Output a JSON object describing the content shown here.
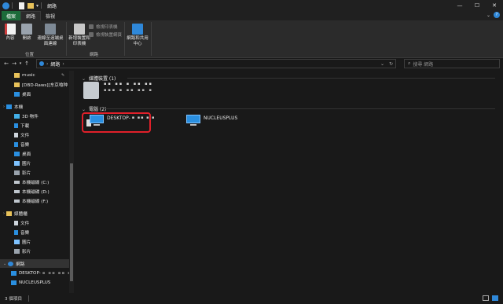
{
  "window": {
    "title": "網路",
    "controls": [
      "—",
      "☐",
      "✕"
    ]
  },
  "tabs": [
    {
      "label": "檔案"
    },
    {
      "label": "網路"
    },
    {
      "label": "檢視"
    }
  ],
  "ribbon": {
    "location_group": {
      "label": "位置",
      "buttons": [
        {
          "label": "內容"
        },
        {
          "label": "開啟"
        },
        {
          "label": "連線至遠端桌面連線"
        }
      ]
    },
    "network_group": {
      "label": "網路",
      "big_button": "新增裝置和印表機",
      "small_buttons": [
        "檢視印表機",
        "檢視裝置網頁"
      ],
      "extra_button": "網路和共用中心"
    }
  },
  "address": {
    "path": "網路",
    "search_placeholder": "搜尋 網路"
  },
  "sidebar": {
    "items": [
      {
        "label": "music"
      },
      {
        "label": "[DBD-Raws][东京喰种"
      },
      {
        "label": "桌面"
      },
      {
        "label": "本機"
      },
      {
        "label": "3D 物件"
      },
      {
        "label": "下載"
      },
      {
        "label": "文件"
      },
      {
        "label": "音樂"
      },
      {
        "label": "桌面"
      },
      {
        "label": "圖片"
      },
      {
        "label": "影片"
      },
      {
        "label": "本機磁碟 (C:)"
      },
      {
        "label": "本機磁碟 (D:)"
      },
      {
        "label": "本機磁碟 (F:)"
      },
      {
        "label": "媒體櫃"
      },
      {
        "label": "文件"
      },
      {
        "label": "音樂"
      },
      {
        "label": "圖片"
      },
      {
        "label": "影片"
      },
      {
        "label": "網路"
      },
      {
        "label": "DESKTOP-"
      },
      {
        "label": "NUCLEUSPLUS"
      }
    ]
  },
  "main": {
    "media_section": "媒體裝置 (1)",
    "computer_section": "電腦 (2)",
    "computers": [
      {
        "name": "DESKTOP-"
      },
      {
        "name": "NUCLEUSPLUS"
      }
    ]
  },
  "status": {
    "count": "3 個項目"
  },
  "colors": {
    "background": "#191919",
    "file_tab": "#1c6b3a",
    "highlight": "#e0202a",
    "accent": "#2a8fe0"
  }
}
